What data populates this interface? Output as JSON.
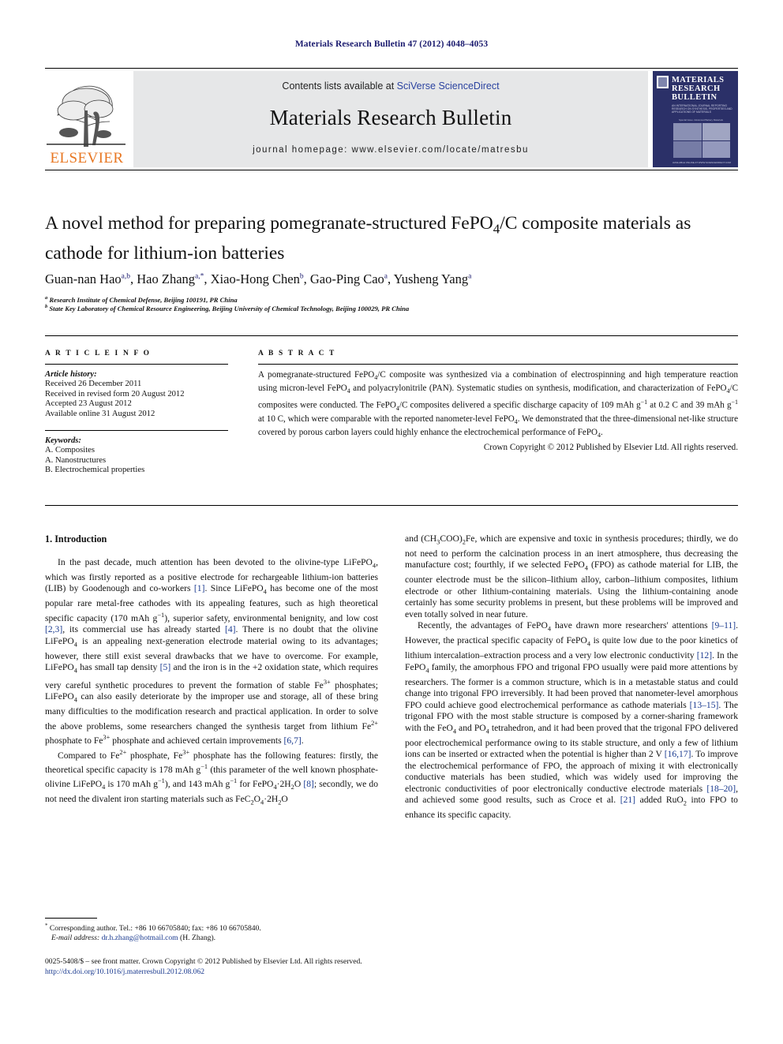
{
  "running_head": "Materials Research Bulletin 47 (2012) 4048–4053",
  "masthead": {
    "elsevier_wordmark": "ELSEVIER",
    "contents_prefix": "Contents lists available at ",
    "contents_link": "SciVerse ScienceDirect",
    "journal_name": "Materials Research Bulletin",
    "journal_homepage": "journal homepage: www.elsevier.com/locate/matresbu",
    "cover": {
      "title_line1": "MATERIALS",
      "title_line2": "RESEARCH",
      "title_line3": "BULLETIN",
      "subtitle": "AN INTERNATIONAL JOURNAL REPORTING RESEARCH ON SYNTHESIS, PROPERTIES AND APPLICATIONS OF MATERIALS",
      "figure_caption": "Special Issue: Advanced Battery Materials",
      "footer": "AVAILABLE ONLINE AT WWW.SCIENCEDIRECT.COM"
    }
  },
  "article": {
    "title": "A novel method for preparing pomegranate-structured FePO4/C composite materials as cathode for lithium-ion batteries",
    "authors_html": "Guan-nan Hao <sup>a,b</sup>, Hao Zhang <sup>a,*</sup>, Xiao-Hong Chen <sup>b</sup>, Gao-Ping Cao <sup>a</sup>, Yusheng Yang <sup>a</sup>",
    "affiliation_a": "Research Institute of Chemical Defense, Beijing 100191, PR China",
    "affiliation_b": "State Key Laboratory of Chemical Resource Engineering, Beijing University of Chemical Technology, Beijing 100029, PR China"
  },
  "article_info": {
    "heading": "A R T I C L E   I N F O",
    "history_label": "Article history:",
    "history": [
      "Received 26 December 2011",
      "Received in revised form 20 August 2012",
      "Accepted 23 August 2012",
      "Available online 31 August 2012"
    ],
    "keywords_label": "Keywords:",
    "keywords": [
      "A. Composites",
      "A. Nanostructures",
      "B. Electrochemical properties"
    ]
  },
  "abstract": {
    "heading": "A B S T R A C T",
    "text": "A pomegranate-structured FePO4/C composite was synthesized via a combination of electrospinning and high temperature reaction using micron-level FePO4 and polyacrylonitrile (PAN). Systematic studies on synthesis, modification, and characterization of FePO4/C composites were conducted. The FePO4/C composites delivered a specific discharge capacity of 109 mAh g−1 at 0.2 C and 39 mAh g−1 at 10 C, which were comparable with the reported nanometer-level FePO4. We demonstrated that the three-dimensional net-like structure covered by porous carbon layers could highly enhance the electrochemical performance of FePO4.",
    "copyright": "Crown Copyright © 2012 Published by Elsevier Ltd. All rights reserved."
  },
  "body": {
    "section_heading": "1. Introduction",
    "left_paragraphs": [
      "In the past decade, much attention has been devoted to the olivine-type LiFePO4, which was firstly reported as a positive electrode for rechargeable lithium-ion batteries (LIB) by Goodenough and co-workers [1]. Since LiFePO4 has become one of the most popular rare metal-free cathodes with its appealing features, such as high theoretical specific capacity (170 mAh g−1), superior safety, environmental benignity, and low cost [2,3], its commercial use has already started [4]. There is no doubt that the olivine LiFePO4 is an appealing next-generation electrode material owing to its advantages; however, there still exist several drawbacks that we have to overcome. For example, LiFePO4 has small tap density [5] and the iron is in the +2 oxidation state, which requires very careful synthetic procedures to prevent the formation of stable Fe3+ phosphates; LiFePO4 can also easily deteriorate by the improper use and storage, all of these bring many difficulties to the modification research and practical application. In order to solve the above problems, some researchers changed the synthesis target from lithium Fe2+ phosphate to Fe3+ phosphate and achieved certain improvements [6,7].",
      "Compared to Fe2+ phosphate, Fe3+ phosphate has the following features: firstly, the theoretical specific capacity is 178 mAh g−1 (this parameter of the well known phosphate-olivine LiFePO4 is 170 mAh g−1), and 143 mAh g−1 for FePO4·2H2O [8]; secondly, we do not need the divalent iron starting materials such as FeC2O4·2H2O"
    ],
    "right_paragraphs": [
      "and (CH3COO)2Fe, which are expensive and toxic in synthesis procedures; thirdly, we do not need to perform the calcination process in an inert atmosphere, thus decreasing the manufacture cost; fourthly, if we selected FePO4 (FPO) as cathode material for LIB, the counter electrode must be the silicon–lithium alloy, carbon–lithium composites, lithium electrode or other lithium-containing materials. Using the lithium-containing anode certainly has some security problems in present, but these problems will be improved and even totally solved in near future.",
      "Recently, the advantages of FePO4 have drawn more researchers' attentions [9–11]. However, the practical specific capacity of FePO4 is quite low due to the poor kinetics of lithium intercalation–extraction process and a very low electronic conductivity [12]. In the FePO4 family, the amorphous FPO and trigonal FPO usually were paid more attentions by researchers. The former is a common structure, which is in a metastable status and could change into trigonal FPO irreversibly. It had been proved that nanometer-level amorphous FPO could achieve good electrochemical performance as cathode materials [13–15]. The trigonal FPO with the most stable structure is composed by a corner-sharing framework with the FeO4 and PO4 tetrahedron, and it had been proved that the trigonal FPO delivered poor electrochemical performance owing to its stable structure, and only a few of lithium ions can be inserted or extracted when the potential is higher than 2 V [16,17]. To improve the electrochemical performance of FPO, the approach of mixing it with electronically conductive materials has been studied, which was widely used for improving the electronic conductivities of poor electronically conductive electrode materials [18–20], and achieved some good results, such as Croce et al. [21] added RuO2 into FPO to enhance its specific capacity."
    ]
  },
  "footnote": {
    "marker": "*",
    "corresponding": "Corresponding author. Tel.: +86 10 66705840; fax: +86 10 66705840.",
    "email_label": "E-mail address:",
    "email": "dr.h.zhang@hotmail.com",
    "email_owner": "(H. Zhang)."
  },
  "bottom_matter": {
    "issn_line": "0025-5408/$ – see front matter. Crown Copyright © 2012 Published by Elsevier Ltd. All rights reserved.",
    "doi": "http://dx.doi.org/10.1016/j.materresbull.2012.08.062"
  },
  "colors": {
    "link_blue": "#2b43a0",
    "ref_blue": "#1a3a8f",
    "running_head_blue": "#1a1a6e",
    "elsevier_orange": "#E87722",
    "contents_grey": "#e6e7e8",
    "cover_navy": "#2b3068"
  }
}
